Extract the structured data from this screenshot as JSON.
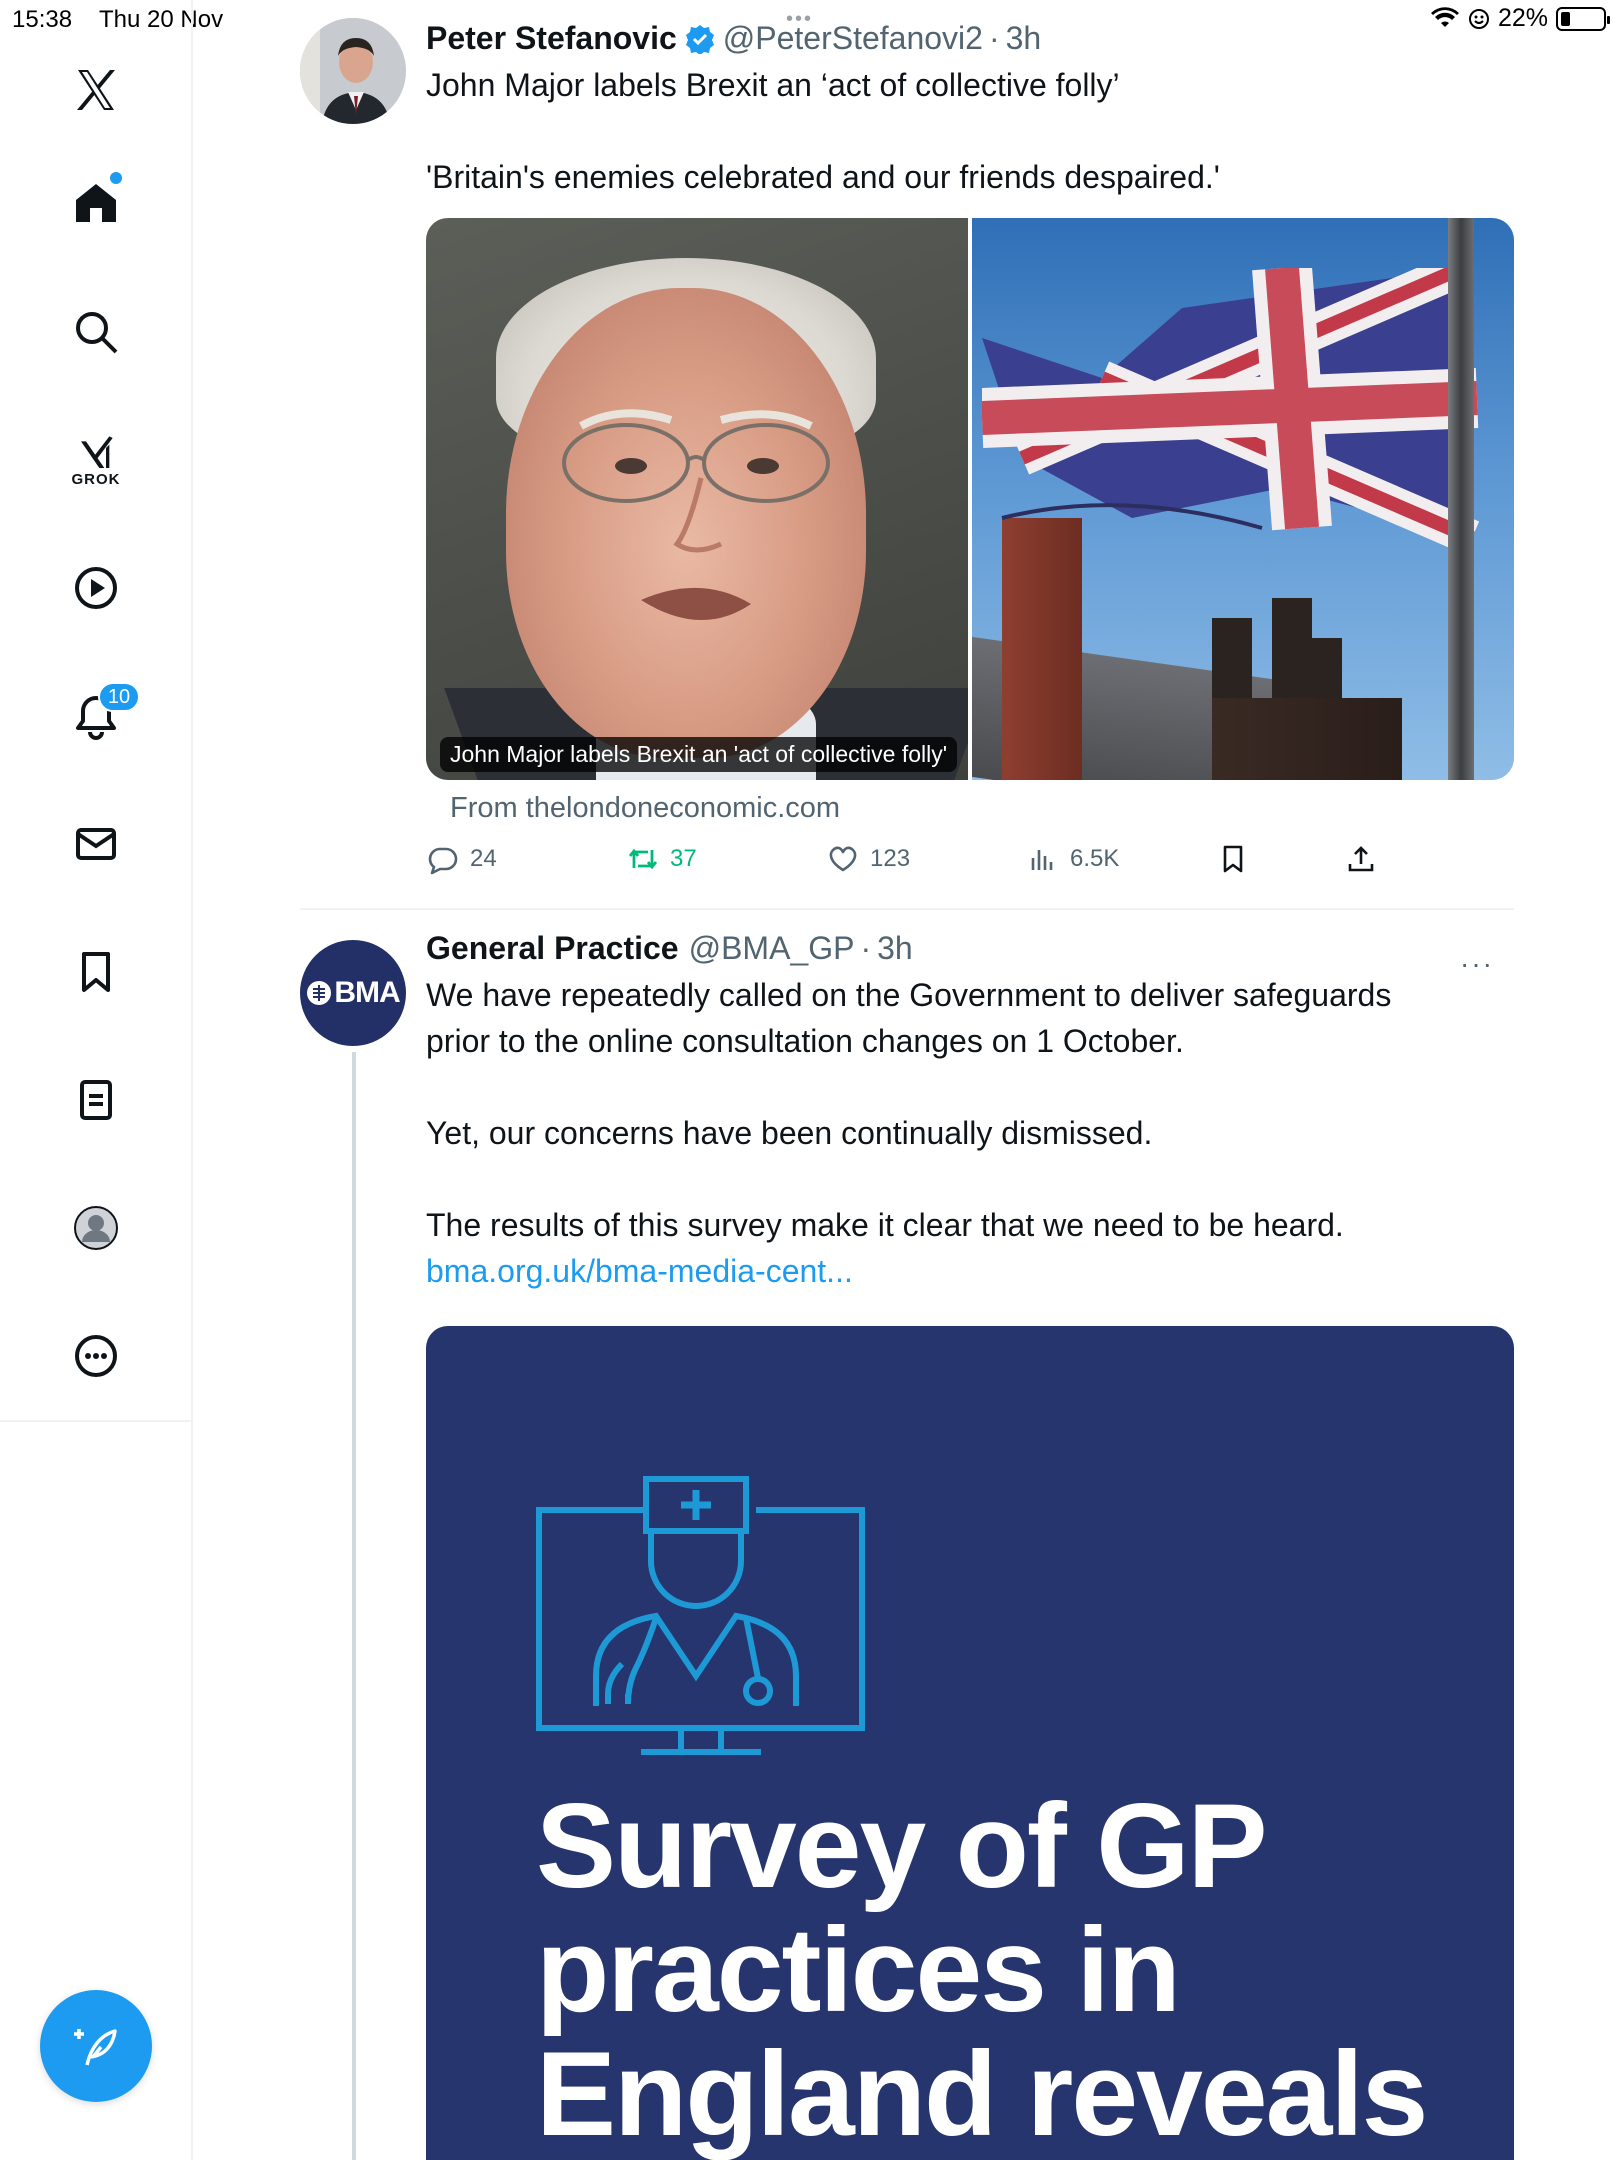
{
  "status": {
    "time": "15:38",
    "date": "Thu 20 Nov",
    "battery": "22%",
    "battery_level": 0.22
  },
  "sidebar": {
    "grok_label": "GROK",
    "notifications_badge": "10"
  },
  "tweets": [
    {
      "name": "Peter Stefanovic",
      "handle": "@PeterStefanovi2",
      "time": "3h",
      "text1": "John Major labels Brexit an ‘act of collective folly’",
      "text2": "'Britain's enemies celebrated and our friends despaired.'",
      "card_caption": "John Major labels Brexit an 'act of collective folly'",
      "card_source": "From thelondoneconomic.com",
      "replies": "24",
      "retweets": "37",
      "likes": "123",
      "views": "6.5K"
    },
    {
      "name": "General Practice",
      "handle": "@BMA_GP",
      "time": "3h",
      "avatar_text": "BMA",
      "line1": "We have repeatedly called on the Government to deliver safeguards",
      "line2": "prior to the online consultation changes on 1 October.",
      "line3": "Yet, our concerns have been continually dismissed.",
      "line4": "The results of this survey make it clear that we need to be heard.",
      "link": "bma.org.uk/bma-media-cent...",
      "survey_line1": "Survey of GP",
      "survey_line2": "practices in",
      "survey_line3": "England reveals"
    }
  ],
  "colors": {
    "accent": "#1d9bf0",
    "bma_navy": "#26356d",
    "bma_cyan": "#1d9ad6",
    "retweet_green": "#00ba7c"
  }
}
